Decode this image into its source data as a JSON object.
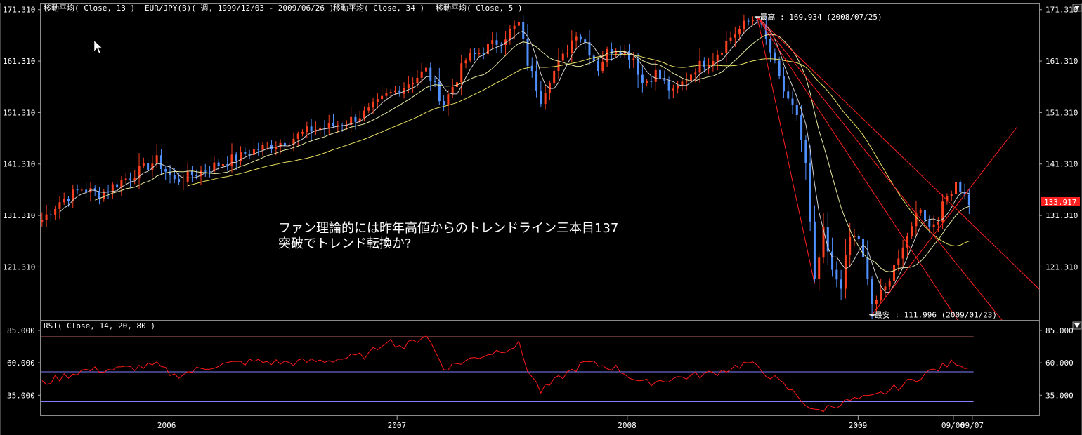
{
  "header": {
    "ma13": "移動平均( Close, 13 )",
    "pair": "EUR/JPY(B)( 週, 1999/12/03 - 2009/06/26 )",
    "ma34": "移動平均( Close, 34 )",
    "ma5": "移動平均( Close, 5 )"
  },
  "rsi_label": "RSI( Close, 14, 20, 80 )",
  "note_line1": "ファン理論的には昨年高値からのトレンドライン三本目137",
  "note_line2": "突破でトレンド転換か?",
  "high_label": "←最高 : 169.934 (2008/07/25)",
  "low_label": "←最安 : 111.996 (2009/01/23)",
  "current_price": "133.917",
  "colors": {
    "up": "#ff4020",
    "down": "#5090ff",
    "ma_fast": "#e8e8a0",
    "ma_slow": "#e8e060",
    "trend": "#ff2020",
    "rsi": "#ff1a1a",
    "rsi_upper": "#ff8080",
    "rsi_lower": "#8080ff",
    "price_tag": "#ff2020"
  },
  "chart_data": [
    {
      "type": "candlestick",
      "title": "EUR/JPY(B)( 週, 1999/12/03 - 2009/06/26 )",
      "price_ticks": [
        "171.310",
        "161.310",
        "151.310",
        "141.310",
        "131.310",
        "121.310"
      ],
      "price_tick_values": [
        171.31,
        161.31,
        151.31,
        141.31,
        131.31,
        121.31
      ],
      "ylim": [
        111.0,
        172.5
      ],
      "x_ticks": [
        "2006",
        "2007",
        "2008",
        "2009",
        "09/06",
        "09/07"
      ],
      "x_tick_dates": [
        "2006-01-01",
        "2007-01-01",
        "2008-01-01",
        "2009-01-01",
        "2009-06-01",
        "2009-07-01"
      ],
      "xlim": [
        "2005-06-15",
        "2009-10-15"
      ],
      "series": [
        {
          "name": "移動平均( Close, 13 )",
          "role": "ma_fast"
        },
        {
          "name": "移動平均( Close, 34 )",
          "role": "ma_slow"
        },
        {
          "name": "移動平均( Close, 5 )",
          "role": "ma_short"
        }
      ],
      "close_anchors": [
        [
          "2005-06-17",
          130.5
        ],
        [
          "2005-07-15",
          134.0
        ],
        [
          "2005-08-19",
          136.5
        ],
        [
          "2005-09-16",
          135.5
        ],
        [
          "2005-10-14",
          137.5
        ],
        [
          "2005-11-18",
          140.0
        ],
        [
          "2005-12-16",
          142.0
        ],
        [
          "2006-01-13",
          138.0
        ],
        [
          "2006-02-17",
          139.5
        ],
        [
          "2006-03-17",
          141.0
        ],
        [
          "2006-04-21",
          142.5
        ],
        [
          "2006-05-19",
          144.0
        ],
        [
          "2006-06-16",
          145.0
        ],
        [
          "2006-07-14",
          146.0
        ],
        [
          "2006-08-18",
          148.0
        ],
        [
          "2006-09-15",
          148.5
        ],
        [
          "2006-10-13",
          149.5
        ],
        [
          "2006-11-17",
          151.5
        ],
        [
          "2006-12-15",
          154.5
        ],
        [
          "2007-01-12",
          156.5
        ],
        [
          "2007-02-16",
          159.5
        ],
        [
          "2007-03-16",
          153.0
        ],
        [
          "2007-04-20",
          161.5
        ],
        [
          "2007-05-18",
          163.5
        ],
        [
          "2007-06-15",
          165.5
        ],
        [
          "2007-07-13",
          168.5
        ],
        [
          "2007-07-27",
          161.0
        ],
        [
          "2007-08-17",
          154.0
        ],
        [
          "2007-08-31",
          158.0
        ],
        [
          "2007-09-21",
          162.0
        ],
        [
          "2007-10-12",
          167.0
        ],
        [
          "2007-10-26",
          165.0
        ],
        [
          "2007-11-16",
          160.0
        ],
        [
          "2007-11-30",
          163.0
        ],
        [
          "2007-12-14",
          164.0
        ],
        [
          "2008-01-11",
          162.0
        ],
        [
          "2008-01-25",
          157.0
        ],
        [
          "2008-02-15",
          159.0
        ],
        [
          "2008-03-14",
          155.0
        ],
        [
          "2008-03-28",
          157.0
        ],
        [
          "2008-04-18",
          160.0
        ],
        [
          "2008-05-16",
          162.0
        ],
        [
          "2008-06-13",
          166.0
        ],
        [
          "2008-07-11",
          169.0
        ],
        [
          "2008-07-25",
          169.9
        ],
        [
          "2008-08-15",
          163.0
        ],
        [
          "2008-09-12",
          153.0
        ],
        [
          "2008-09-26",
          151.0
        ],
        [
          "2008-10-10",
          141.0
        ],
        [
          "2008-10-24",
          118.0
        ],
        [
          "2008-11-07",
          128.0
        ],
        [
          "2008-11-21",
          120.0
        ],
        [
          "2008-12-05",
          118.0
        ],
        [
          "2008-12-19",
          127.0
        ],
        [
          "2009-01-02",
          127.0
        ],
        [
          "2009-01-23",
          114.0
        ],
        [
          "2009-02-13",
          117.0
        ],
        [
          "2009-02-27",
          122.0
        ],
        [
          "2009-03-13",
          124.0
        ],
        [
          "2009-03-27",
          130.0
        ],
        [
          "2009-04-10",
          133.0
        ],
        [
          "2009-04-24",
          129.0
        ],
        [
          "2009-05-08",
          131.0
        ],
        [
          "2009-05-22",
          135.0
        ],
        [
          "2009-06-05",
          138.0
        ],
        [
          "2009-06-19",
          135.0
        ],
        [
          "2009-06-26",
          133.9
        ]
      ],
      "annotations": {
        "high": {
          "date": "2008-07-25",
          "price": 169.934
        },
        "low": {
          "date": "2009-01-23",
          "price": 111.996
        },
        "current": 133.917
      },
      "trend_lines": [
        {
          "from": [
            "2008-07-25",
            169.934
          ],
          "to": [
            "2009-10-15",
            117.0
          ]
        },
        {
          "from": [
            "2008-07-25",
            169.934
          ],
          "to": [
            "2009-10-15",
            102.0
          ]
        },
        {
          "from": [
            "2008-07-25",
            169.934
          ],
          "to": [
            "2009-10-15",
            87.0
          ]
        },
        {
          "from": [
            "2009-01-23",
            111.996
          ],
          "to": [
            "2009-09-10",
            148.5
          ]
        }
      ]
    },
    {
      "type": "line",
      "title": "RSI( Close, 14, 20, 80 )",
      "y_ticks": [
        "85.000",
        "60.000",
        "35.000"
      ],
      "y_tick_values": [
        85,
        60,
        35
      ],
      "ylim": [
        20,
        92
      ],
      "upper_band": 80,
      "lower_band": 30,
      "mid_band": 53,
      "rsi_anchors": [
        [
          "2005-06-17",
          44
        ],
        [
          "2005-08-19",
          54
        ],
        [
          "2005-10-14",
          55
        ],
        [
          "2005-12-16",
          58
        ],
        [
          "2006-01-13",
          50
        ],
        [
          "2006-03-17",
          58
        ],
        [
          "2006-05-19",
          61
        ],
        [
          "2006-07-14",
          60
        ],
        [
          "2006-09-15",
          62
        ],
        [
          "2006-11-17",
          66
        ],
        [
          "2006-12-15",
          78
        ],
        [
          "2007-01-12",
          72
        ],
        [
          "2007-02-16",
          82
        ],
        [
          "2007-03-16",
          56
        ],
        [
          "2007-05-18",
          66
        ],
        [
          "2007-07-13",
          74
        ],
        [
          "2007-07-27",
          55
        ],
        [
          "2007-08-17",
          38
        ],
        [
          "2007-09-21",
          50
        ],
        [
          "2007-10-26",
          60
        ],
        [
          "2007-12-14",
          56
        ],
        [
          "2008-01-25",
          44
        ],
        [
          "2008-03-14",
          48
        ],
        [
          "2008-05-16",
          52
        ],
        [
          "2008-07-11",
          60
        ],
        [
          "2008-08-15",
          50
        ],
        [
          "2008-09-26",
          35
        ],
        [
          "2008-10-24",
          22
        ],
        [
          "2008-11-21",
          27
        ],
        [
          "2008-12-19",
          31
        ],
        [
          "2009-01-23",
          33
        ],
        [
          "2009-03-13",
          43
        ],
        [
          "2009-04-24",
          53
        ],
        [
          "2009-06-05",
          61
        ],
        [
          "2009-06-26",
          56
        ]
      ]
    }
  ]
}
